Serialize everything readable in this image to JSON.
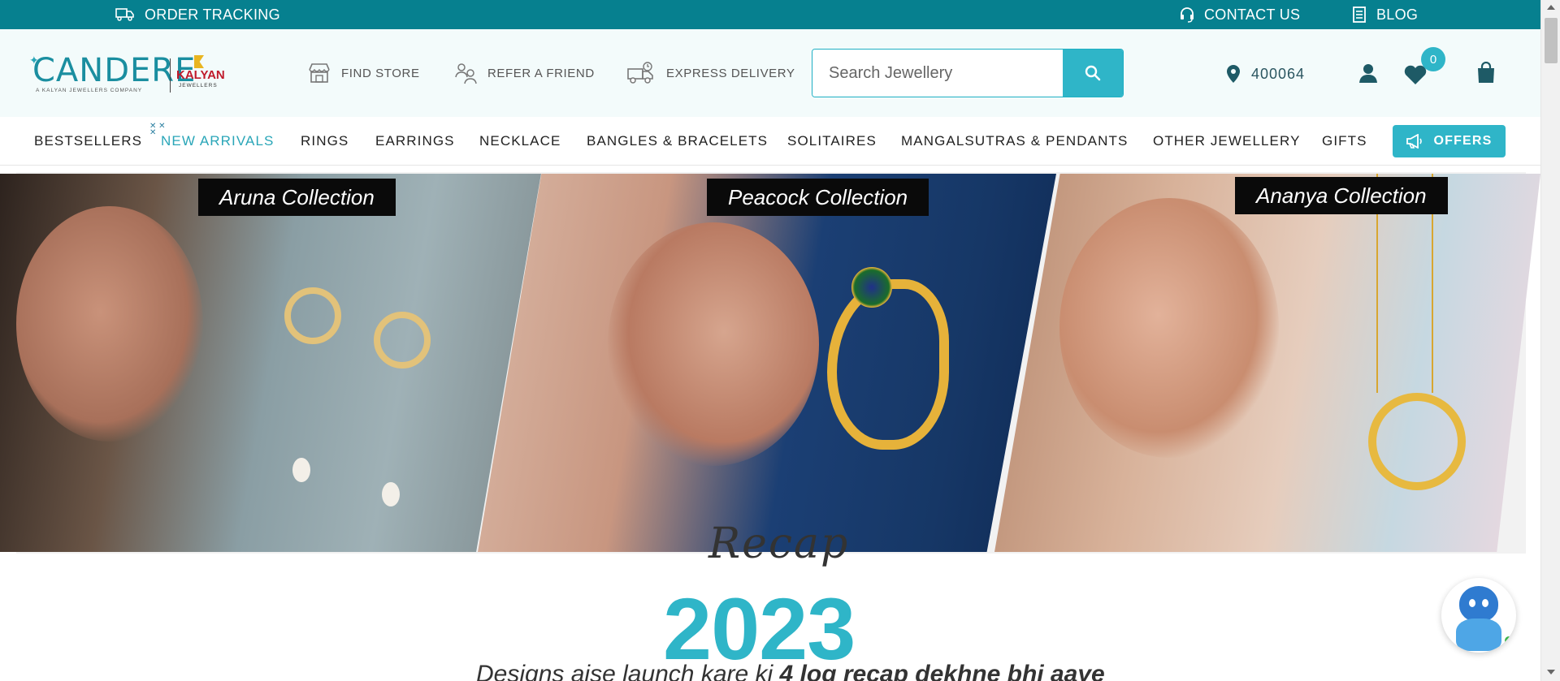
{
  "topbar": {
    "order_tracking": "ORDER TRACKING",
    "contact_us": "CONTACT US",
    "blog": "BLOG"
  },
  "logo": {
    "brand": "CANDERE",
    "tagline": "A KALYAN JEWELLERS COMPANY",
    "partner": "KALYAN",
    "partner_sub": "JEWELLERS"
  },
  "header": {
    "find_store": "FIND STORE",
    "refer_friend": "REFER A FRIEND",
    "express_delivery": "EXPRESS DELIVERY",
    "search_placeholder": "Search Jewellery",
    "pincode": "400064",
    "wishlist_count": "0"
  },
  "nav": {
    "items": [
      "BESTSELLERS",
      "NEW ARRIVALS",
      "RINGS",
      "EARRINGS",
      "NECKLACE",
      "BANGLES & BRACELETS",
      "SOLITAIRES",
      "MANGALSUTRAS & PENDANTS",
      "OTHER JEWELLERY",
      "GIFTS"
    ],
    "offers": "OFFERS"
  },
  "hero": {
    "collections": [
      "Aruna Collection",
      "Peacock Collection",
      "Ananya Collection"
    ]
  },
  "recap": {
    "script": "Recap",
    "year": "2023",
    "subtitle_regular": "Designs aise launch kare ki ",
    "subtitle_bold": "4 log recap dekhne bhi aaye"
  },
  "colors": {
    "topbar": "#06808f",
    "accent": "#2fb5c8",
    "header_bg": "#f3fbfb"
  },
  "icons": {
    "order_tracking": "truck-icon",
    "contact_us": "headset-icon",
    "blog": "document-icon",
    "find_store": "store-icon",
    "refer_friend": "users-icon",
    "express_delivery": "delivery-truck-icon",
    "search": "search-icon",
    "pincode": "location-pin-icon",
    "account": "user-icon",
    "wishlist": "heart-icon",
    "cart": "shopping-bag-icon",
    "offers": "megaphone-icon",
    "chatbot": "chatbot-icon"
  }
}
